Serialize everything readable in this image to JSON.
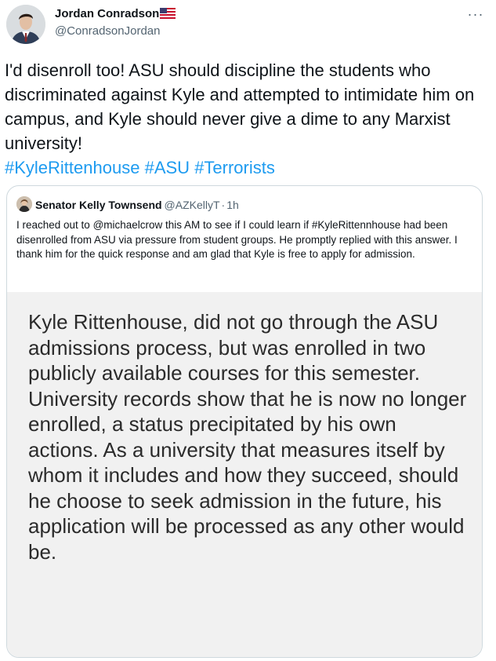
{
  "author": {
    "name": "Jordan Conradson",
    "handle": "@ConradsonJordan",
    "flag_icon": "us-flag-icon",
    "more_icon": "more-options-icon"
  },
  "tweet": {
    "text": "I'd disenroll too! ASU should discipline the students who discriminated against Kyle and attempted to intimidate him on campus, and Kyle should never give a dime to any Marxist university!",
    "hashtags": [
      "#KyleRittenhouse",
      "#ASU",
      "#Terrorists"
    ]
  },
  "quoted": {
    "name": "Senator Kelly Townsend",
    "handle": "@AZKellyT",
    "separator": "·",
    "time": "1h",
    "text": "I reached out to @michaelcrow this AM to see if I could learn if #KyleRittennhouse had been disenrolled from ASU via pressure from student groups.  He promptly replied with this answer.  I thank him for the quick response and am glad that Kyle is free to apply for admission.",
    "image_text": "Kyle Rittenhouse, did not go through the ASU admissions process, but was enrolled in two publicly available courses for this semester. University records show that he is now no longer enrolled, a status precipitated by his own actions.  As a university that measures itself by whom it includes and how they succeed, should he choose to seek admission in the future, his application will be processed as any other would be."
  },
  "colors": {
    "link": "#1d9bf0",
    "secondary_text": "#536471",
    "border": "#cfd9de",
    "image_background": "#f1f1f1"
  }
}
